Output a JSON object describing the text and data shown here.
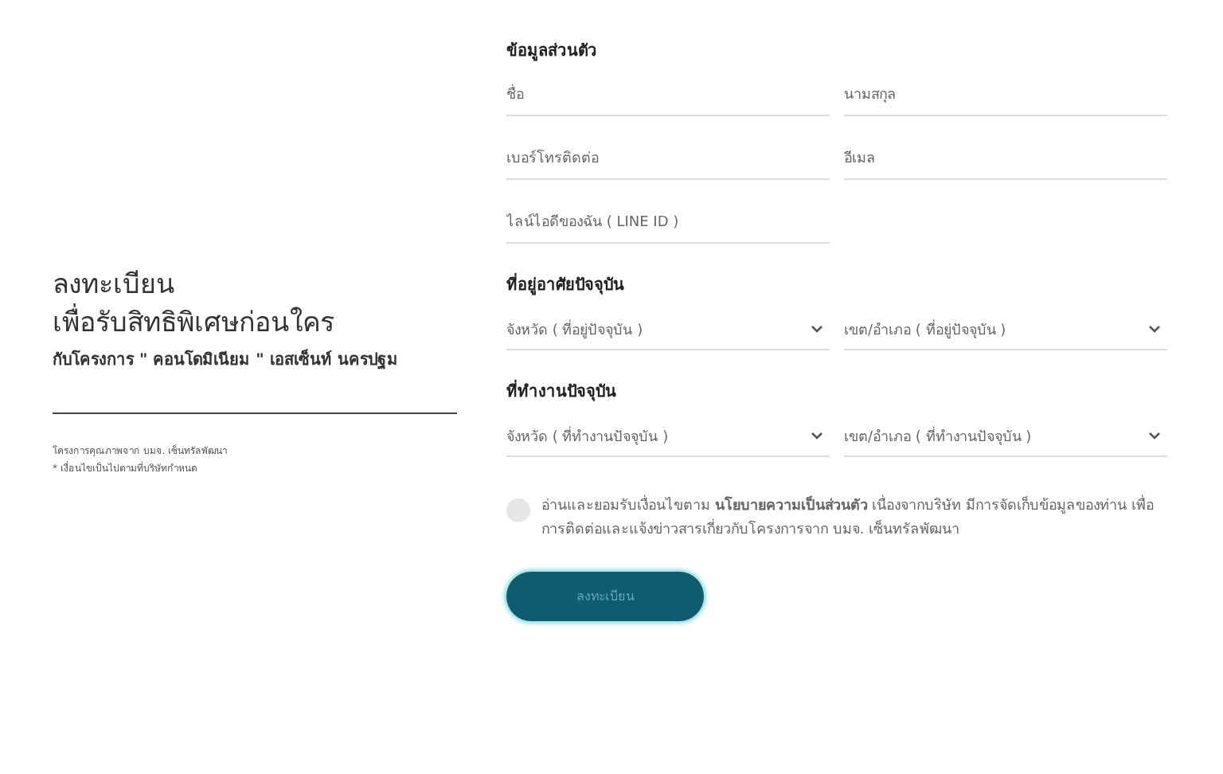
{
  "intro": {
    "title_lines": [
      "ลงทะเบียน",
      "เพื่อรับสิทธิพิเศษก่อนใคร"
    ],
    "subtitle": "กับโครงการ \" คอนโดมิเนียม \" เอสเซ็นท์ นครปฐม",
    "notes": [
      "โครงการคุณภาพจาก บมจ. เซ็นทรัลพัฒนา",
      "* เงื่อนไขเป็นไปตามที่บริษัทกำหนด"
    ]
  },
  "sections": [
    {
      "heading": "ข้อมูลส่วนตัว",
      "fields": [
        {
          "kind": "text",
          "placeholder": "ชื่อ"
        },
        {
          "kind": "text",
          "placeholder": "นามสกุล"
        },
        {
          "kind": "text",
          "placeholder": "เบอร์โทรติดต่อ"
        },
        {
          "kind": "text",
          "placeholder": "อีเมล"
        },
        {
          "kind": "text",
          "placeholder": "ไลน์ไอดีของฉัน ( LINE ID )"
        }
      ]
    },
    {
      "heading": "ที่อยู่อาศัยปัจจุบัน",
      "fields": [
        {
          "kind": "select",
          "placeholder": "จังหวัด ( ที่อยู่ปัจจุบัน )"
        },
        {
          "kind": "select",
          "placeholder": "เขต/อำเภอ ( ที่อยู่ปัจจุบัน )"
        }
      ]
    },
    {
      "heading": "ที่ทำงานปัจจุบัน",
      "fields": [
        {
          "kind": "select",
          "placeholder": "จังหวัด ( ที่ทำงานปัจจุบัน )"
        },
        {
          "kind": "select",
          "placeholder": "เขต/อำเภอ ( ที่ทำงานปัจจุบัน )"
        }
      ]
    }
  ],
  "consent": {
    "checked": false,
    "text": "อ่านและยอมรับเงื่อนไขตาม **นโยบายความเป็นส่วนตัว** เนื่องจากบริษัท มีการจัดเก็บข้อมูลของท่าน เพื่อการติดต่อและแจ้งข่าวสารเกี่ยวกับโครงการจาก บมจ. เซ็นทรัลพัฒนา"
  },
  "submit": {
    "label": "ลงทะเบียน"
  }
}
